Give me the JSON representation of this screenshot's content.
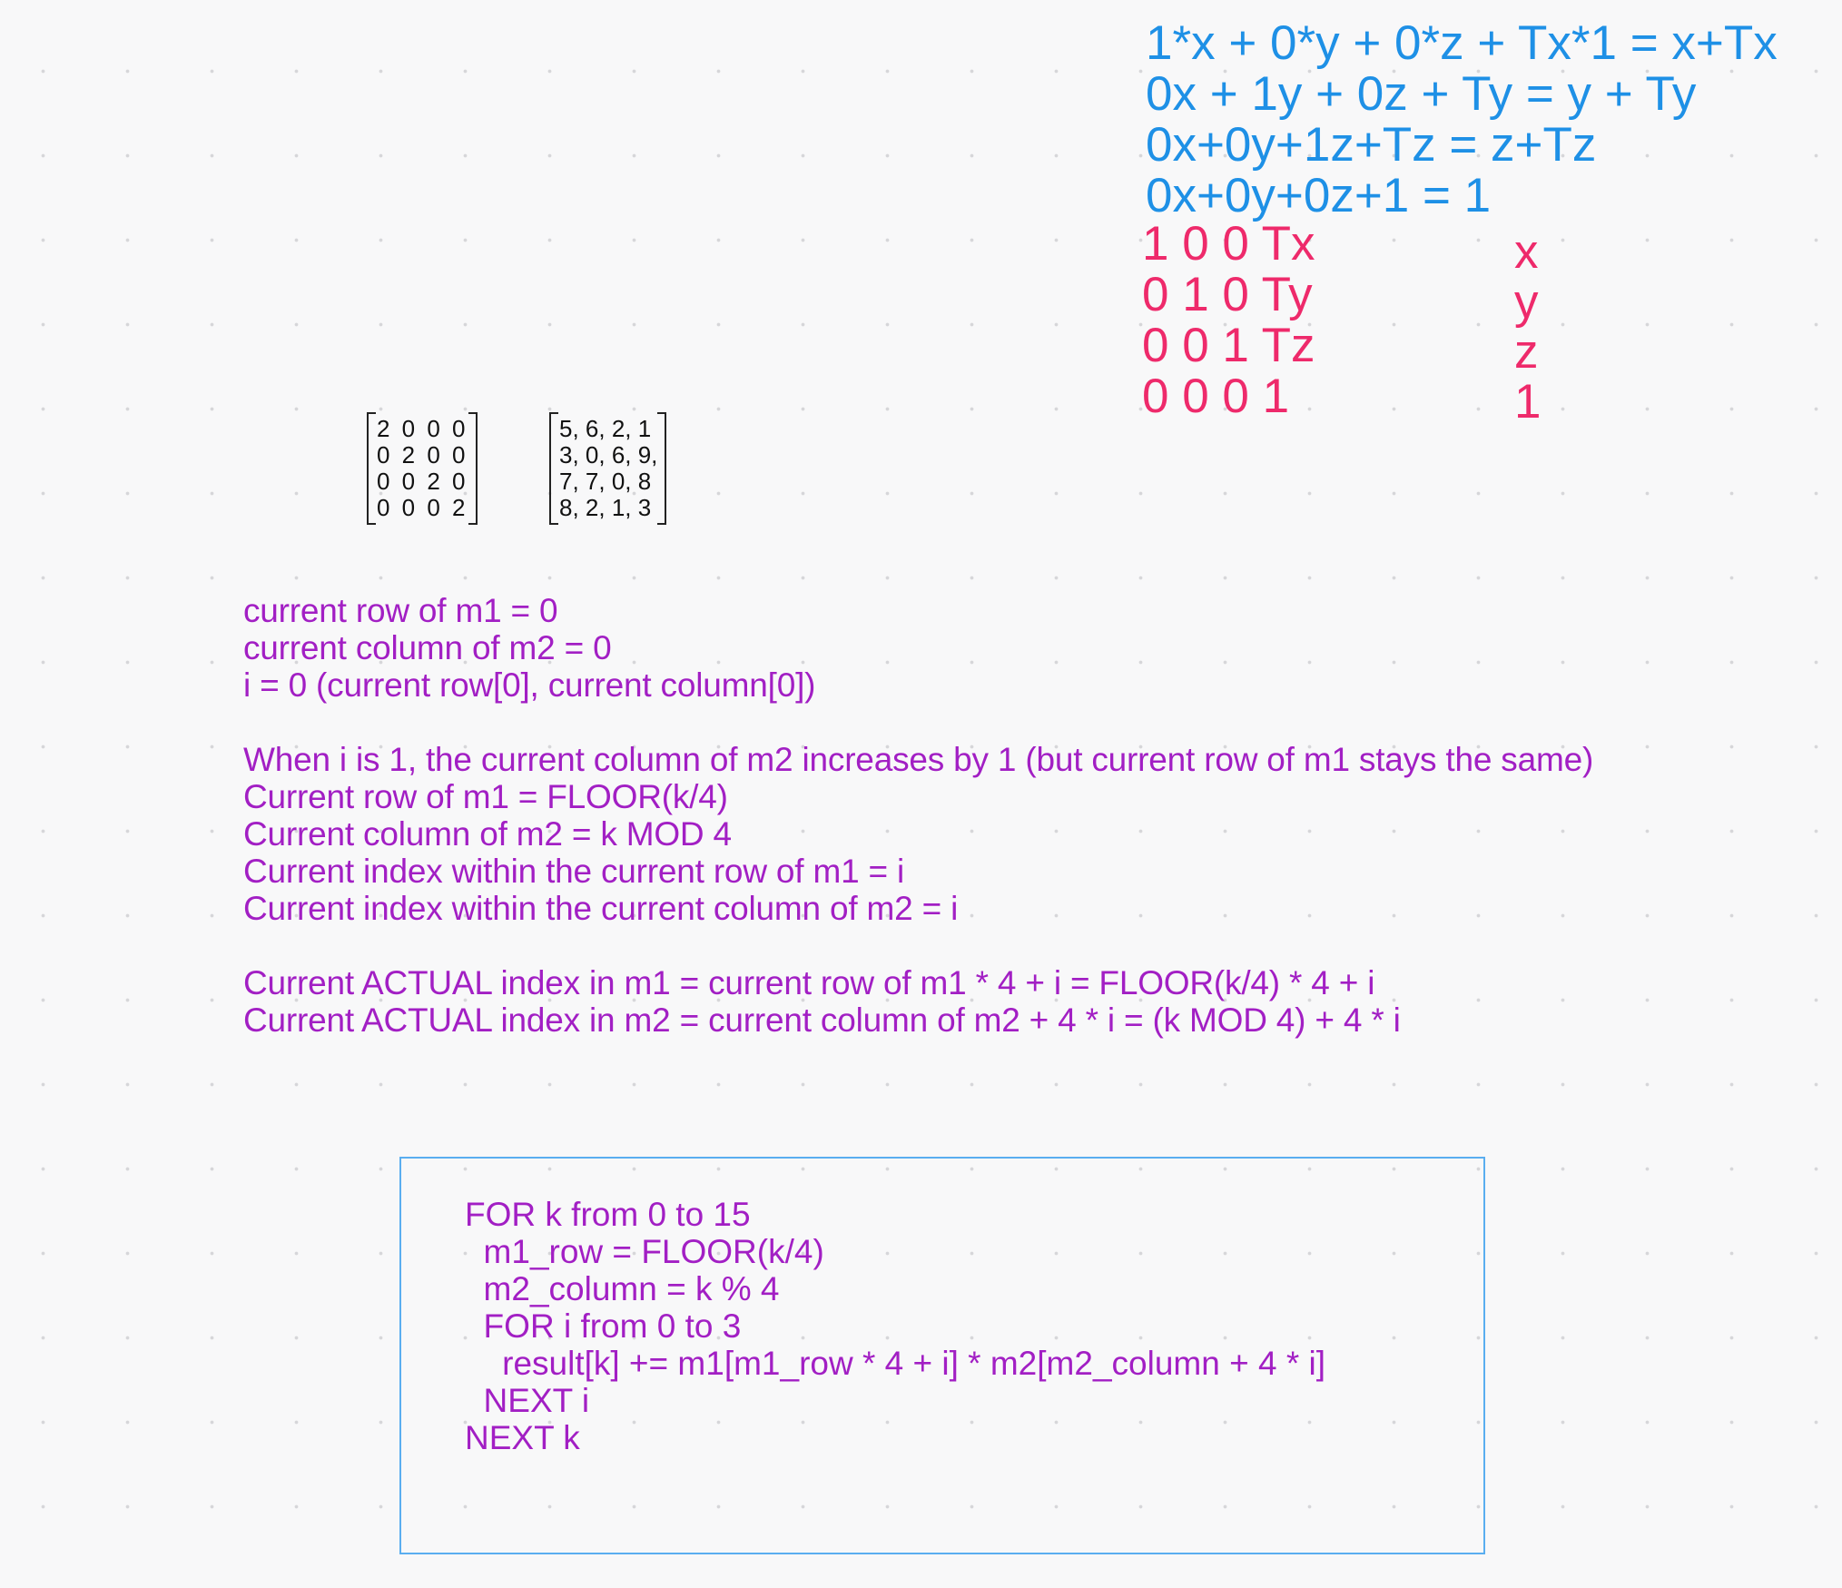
{
  "equations_blue": [
    "1*x + 0*y + 0*z + Tx*1 = x+Tx",
    "0x + 1y + 0z + Ty = y + Ty",
    "0x+0y+1z+Tz = z+Tz",
    "0x+0y+0z+1 = 1"
  ],
  "translation_matrix_rows": [
    "1 0 0 Tx",
    "0 1 0 Ty",
    "0 0 1 Tz",
    "0 0 0 1"
  ],
  "vector_entries": [
    "x",
    "y",
    "z",
    "1"
  ],
  "matrix_m1_rows": [
    "2 0 0 0",
    "0 2 0 0",
    "0 0 2 0",
    "0 0 0 2"
  ],
  "matrix_m2_rows": [
    "5, 6, 2, 1",
    "3, 0, 6, 9,",
    "7, 7, 0, 8",
    "8, 2, 1, 3"
  ],
  "notes": [
    "current row of m1 = 0",
    "current column of m2 = 0",
    "i = 0 (current row[0], current column[0])",
    "",
    "When i is 1, the current column of m2 increases by 1 (but current row of m1 stays the same)",
    "Current row of m1 = FLOOR(k/4)",
    "Current column of m2 = k MOD 4",
    "Current index within the current row of m1 = i",
    "Current index within the current column of m2 = i",
    "",
    "Current ACTUAL index in m1 = current row of m1 * 4 + i = FLOOR(k/4) * 4 + i",
    "Current ACTUAL index in m2 = current column of m2 + 4 * i = (k MOD 4) + 4 * i"
  ],
  "code_lines": [
    "FOR k from 0 to 15",
    "  m1_row = FLOOR(k/4)",
    "  m2_column = k % 4",
    "  FOR i from 0 to 3",
    "    result[k] += m1[m1_row * 4 + i] * m2[m2_column + 4 * i]",
    "  NEXT i",
    "NEXT k"
  ],
  "colors": {
    "blue_text": "#1e90e6",
    "pink_text": "#ee2a6b",
    "purple_text": "#a21fc4",
    "box_border": "#5aaef0",
    "canvas_background": "#f8f8f9"
  }
}
